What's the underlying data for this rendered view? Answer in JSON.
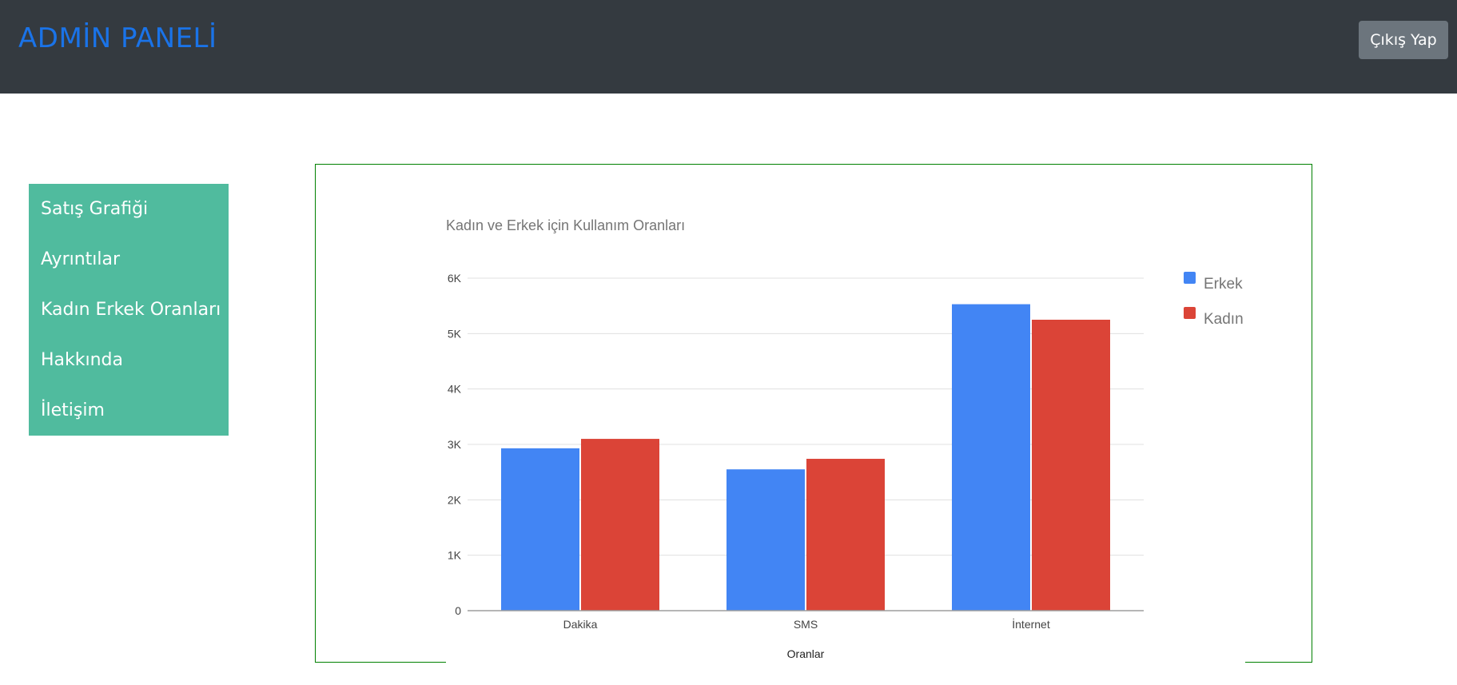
{
  "header": {
    "brand": "ADMİN PANELİ",
    "logout_label": "Çıkış Yap"
  },
  "sidebar": {
    "items": [
      {
        "label": "Satış Grafiği"
      },
      {
        "label": "Ayrıntılar"
      },
      {
        "label": "Kadın Erkek Oranları"
      },
      {
        "label": "Hakkında"
      },
      {
        "label": "İletişim"
      }
    ]
  },
  "colors": {
    "header_bg": "#343a40",
    "brand": "#1a73e8",
    "sidebar_bg": "#50bb9e",
    "chart_border": "#008000"
  },
  "chart_data": {
    "type": "bar",
    "title": "Kadın ve Erkek için Kullanım Oranları",
    "xlabel": "Oranlar",
    "ylabel": "",
    "categories": [
      "Dakika",
      "SMS",
      "İnternet"
    ],
    "series": [
      {
        "name": "Erkek",
        "color": "#4285f4",
        "values": [
          2930,
          2550,
          5530
        ]
      },
      {
        "name": "Kadın",
        "color": "#db4437",
        "values": [
          3100,
          2740,
          5250
        ]
      }
    ],
    "ylim": [
      0,
      6000
    ],
    "yticks": [
      0,
      1000,
      2000,
      3000,
      4000,
      5000,
      6000
    ],
    "ytick_labels": [
      "0",
      "1K",
      "2K",
      "3K",
      "4K",
      "5K",
      "6K"
    ],
    "grid": true,
    "legend": "right"
  }
}
